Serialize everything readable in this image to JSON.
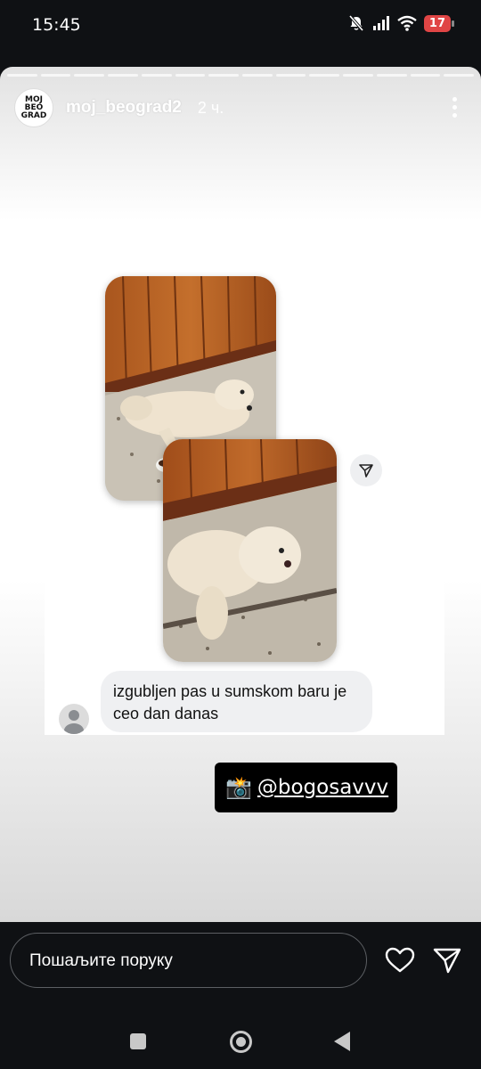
{
  "status": {
    "time": "15:45",
    "battery": "17"
  },
  "story": {
    "username": "moj_beograd2",
    "time_ago": "2 ч.",
    "logo_text": "MOJ BEOGRAD",
    "message": "izgubljen pas u sumskom baru je ceo dan danas",
    "mention": "@bogosavvv",
    "progress_segments": 14
  },
  "reply": {
    "placeholder": "Пошаљите поруку"
  },
  "icons": {
    "more": "more-vertical-icon",
    "share": "paper-plane-icon",
    "heart": "heart-icon",
    "send": "send-icon",
    "camera": "camera-flash-emoji"
  }
}
